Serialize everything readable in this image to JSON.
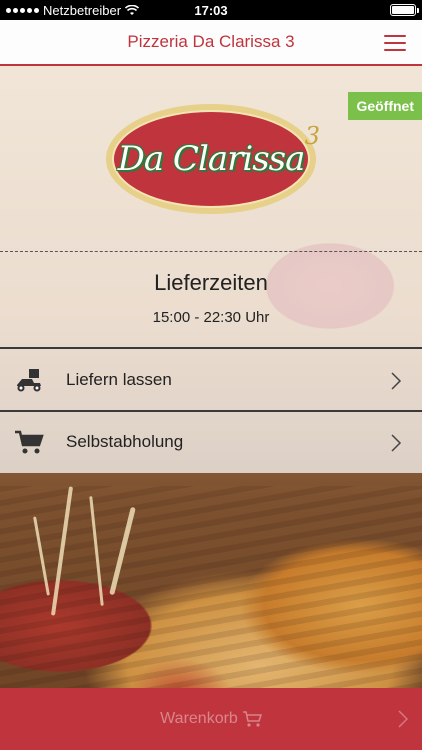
{
  "status_bar": {
    "carrier": "Netzbetreiber",
    "time": "17:03"
  },
  "nav": {
    "title": "Pizzeria Da Clarissa 3",
    "menu_icon": "hamburger-menu-icon"
  },
  "restaurant": {
    "status_badge": "Geöffnet",
    "logo_text": "Da Clarissa",
    "logo_superscript": "3"
  },
  "delivery": {
    "title": "Lieferzeiten",
    "hours": "15:00 - 22:30 Uhr"
  },
  "options": [
    {
      "label": "Liefern lassen",
      "icon": "delivery-scooter-icon"
    },
    {
      "label": "Selbstabholung",
      "icon": "shopping-cart-icon"
    }
  ],
  "cart": {
    "label": "Warenkorb",
    "icon": "shopping-cart-icon"
  },
  "colors": {
    "accent": "#c0343d",
    "open_badge": "#7bc04a"
  }
}
